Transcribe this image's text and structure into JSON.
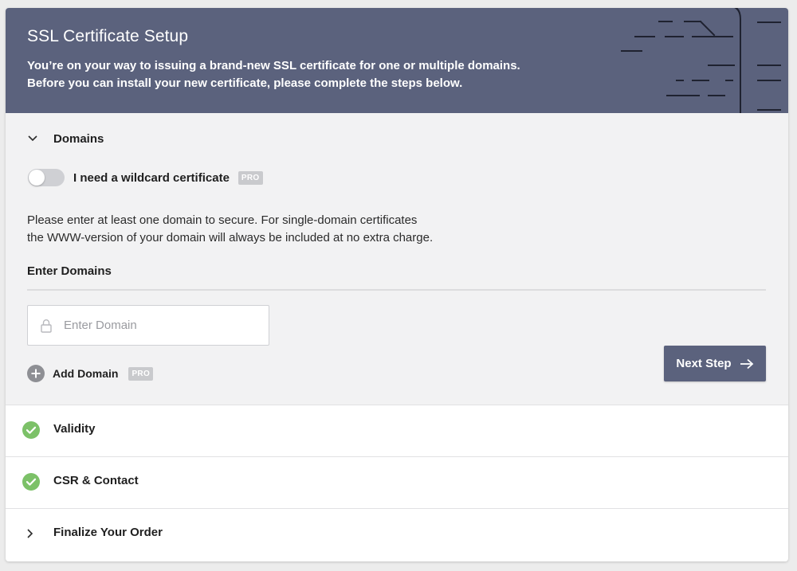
{
  "header": {
    "title": "SSL Certificate Setup",
    "description_line1": "You’re on your way to issuing a brand-new SSL certificate for one or multiple domains.",
    "description_line2": "Before you can install your new certificate, please complete the steps below."
  },
  "domains_section": {
    "title": "Domains",
    "expanded": true,
    "wildcard": {
      "label": "I need a wildcard certificate",
      "badge": "PRO",
      "enabled": false
    },
    "info_line1": "Please enter at least one domain to secure. For single-domain certificates",
    "info_line2": "the WWW-version of your domain will always be included at no extra charge.",
    "enter_label": "Enter Domains",
    "domain_input": {
      "placeholder": "Enter Domain",
      "value": ""
    },
    "add_domain": {
      "label": "Add Domain",
      "badge": "PRO"
    },
    "next_button": {
      "label": "Next Step"
    }
  },
  "sections": [
    {
      "title": "Validity",
      "status": "complete"
    },
    {
      "title": "CSR & Contact",
      "status": "complete"
    },
    {
      "title": "Finalize Your Order",
      "status": "collapsed"
    }
  ],
  "colors": {
    "header_bg": "#5b627d",
    "accent": "#5b627d",
    "success": "#7cc168",
    "badge": "#c9cacd",
    "panel_bg": "#f2f2f3"
  },
  "icons": [
    "chevron-down-icon",
    "lock-icon",
    "plus-circle-icon",
    "arrow-right-icon",
    "check-circle-icon",
    "chevron-right-icon"
  ]
}
